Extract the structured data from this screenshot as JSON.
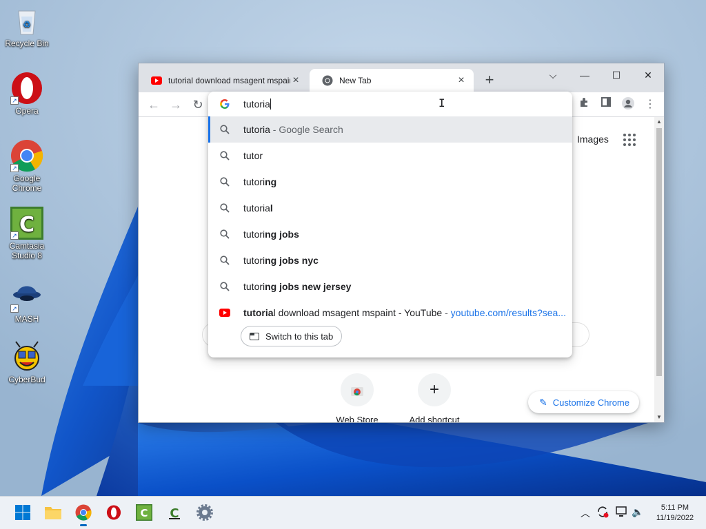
{
  "desktop": {
    "icons": [
      {
        "label": "Recycle Bin",
        "icon": "recycle-bin-icon"
      },
      {
        "label": "Opera",
        "icon": "opera-icon"
      },
      {
        "label": "Google Chrome",
        "icon": "chrome-icon"
      },
      {
        "label": "Camtasia Studio 8",
        "icon": "camtasia-icon"
      },
      {
        "label": "MASH",
        "icon": "mash-icon"
      },
      {
        "label": "CyberBud",
        "icon": "cyberbud-icon"
      }
    ]
  },
  "browser": {
    "tabs": [
      {
        "title": "tutorial download msagent mspaint - YouTube",
        "favicon": "youtube-icon",
        "active": false
      },
      {
        "title": "New Tab",
        "favicon": "chrome-icon",
        "active": true
      }
    ],
    "new_tab_label": "+",
    "window_controls": {
      "tab_search": "⌵",
      "minimize": "—",
      "maximize": "☐",
      "close": "✕"
    },
    "omnibox": {
      "value": "tutoria",
      "suggestions": [
        {
          "prefix": "tutoria",
          "bold": "",
          "suffix": " - Google Search",
          "icon": "search-icon",
          "selected": true
        },
        {
          "prefix": "tutor",
          "bold": "",
          "suffix": "",
          "icon": "search-icon",
          "selected": false
        },
        {
          "prefix": "tutori",
          "bold": "ng",
          "suffix": "",
          "icon": "search-icon",
          "selected": false
        },
        {
          "prefix": "tutoria",
          "bold": "l",
          "suffix": "",
          "icon": "search-icon",
          "selected": false
        },
        {
          "prefix": "tutori",
          "bold": "ng jobs",
          "suffix": "",
          "icon": "search-icon",
          "selected": false
        },
        {
          "prefix": "tutori",
          "bold": "ng jobs nyc",
          "suffix": "",
          "icon": "search-icon",
          "selected": false
        },
        {
          "prefix": "tutori",
          "bold": "ng jobs new jersey",
          "suffix": "",
          "icon": "search-icon",
          "selected": false
        }
      ],
      "tab_match": {
        "bold": "tutoria",
        "rest": "l download msagent mspaint - YouTube",
        "sep": " - ",
        "url": "youtube.com/results?sea...",
        "icon": "youtube-icon"
      },
      "switch_button": "Switch to this tab"
    },
    "page": {
      "images_link": "Images",
      "shortcuts": [
        {
          "label": "Web Store",
          "icon": "web-store-icon"
        },
        {
          "label": "Add shortcut",
          "icon": "plus-icon"
        }
      ],
      "customize_button": "Customize Chrome"
    }
  },
  "taskbar": {
    "apps": [
      "start-icon",
      "file-explorer-icon",
      "chrome-icon",
      "opera-icon",
      "camtasia-icon",
      "camtasia-recorder-icon",
      "settings-icon"
    ],
    "clock": {
      "time": "5:11 PM",
      "date": "11/19/2022"
    }
  },
  "colors": {
    "accent": "#1a73e8",
    "youtube_red": "#ff0000",
    "opera_red": "#cc0f16"
  }
}
